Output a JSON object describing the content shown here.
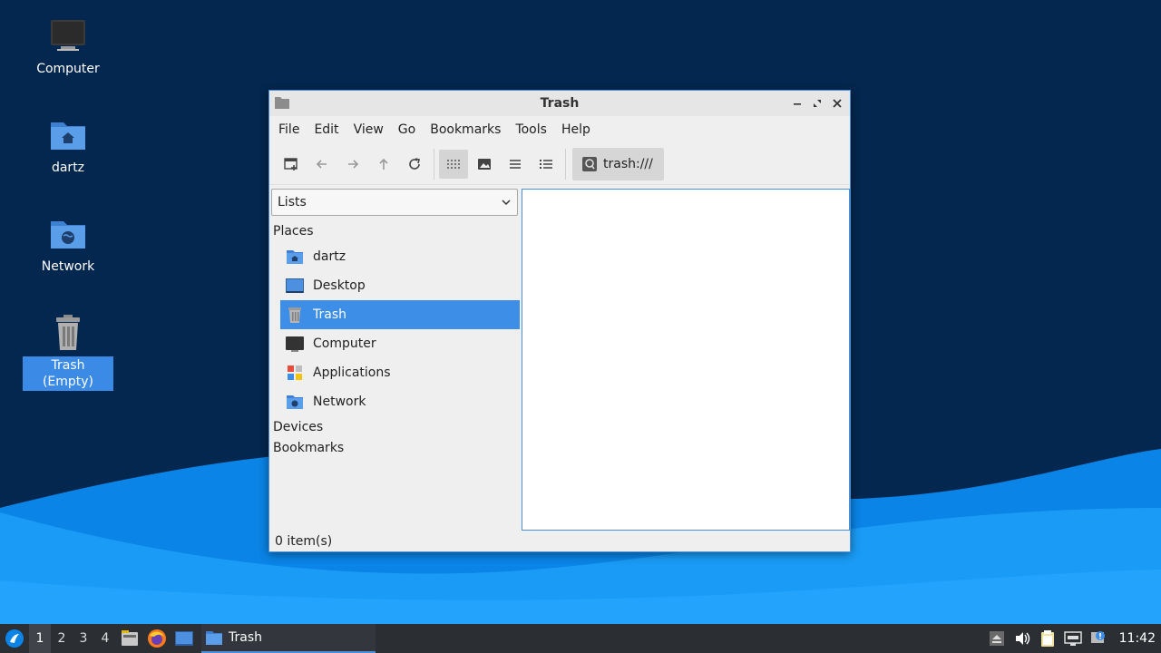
{
  "desktop": {
    "icons": [
      {
        "label": "Computer"
      },
      {
        "label": "dartz"
      },
      {
        "label": "Network"
      },
      {
        "label": "Trash (Empty)"
      }
    ]
  },
  "window": {
    "title": "Trash",
    "menu": [
      "File",
      "Edit",
      "View",
      "Go",
      "Bookmarks",
      "Tools",
      "Help"
    ],
    "location": "trash:///",
    "side_pane": {
      "mode": "Lists",
      "sections": {
        "places": "Places",
        "devices": "Devices",
        "bookmarks": "Bookmarks"
      },
      "places": [
        {
          "label": "dartz"
        },
        {
          "label": "Desktop"
        },
        {
          "label": "Trash"
        },
        {
          "label": "Computer"
        },
        {
          "label": "Applications"
        },
        {
          "label": "Network"
        }
      ]
    },
    "status": "0 item(s)"
  },
  "taskbar": {
    "workspaces": [
      "1",
      "2",
      "3",
      "4"
    ],
    "active_window": "Trash",
    "clock": "11:42"
  },
  "colors": {
    "accent": "#3d8ee7",
    "desktop_bg": "#04274f",
    "taskbar_bg": "#2b2e33"
  }
}
